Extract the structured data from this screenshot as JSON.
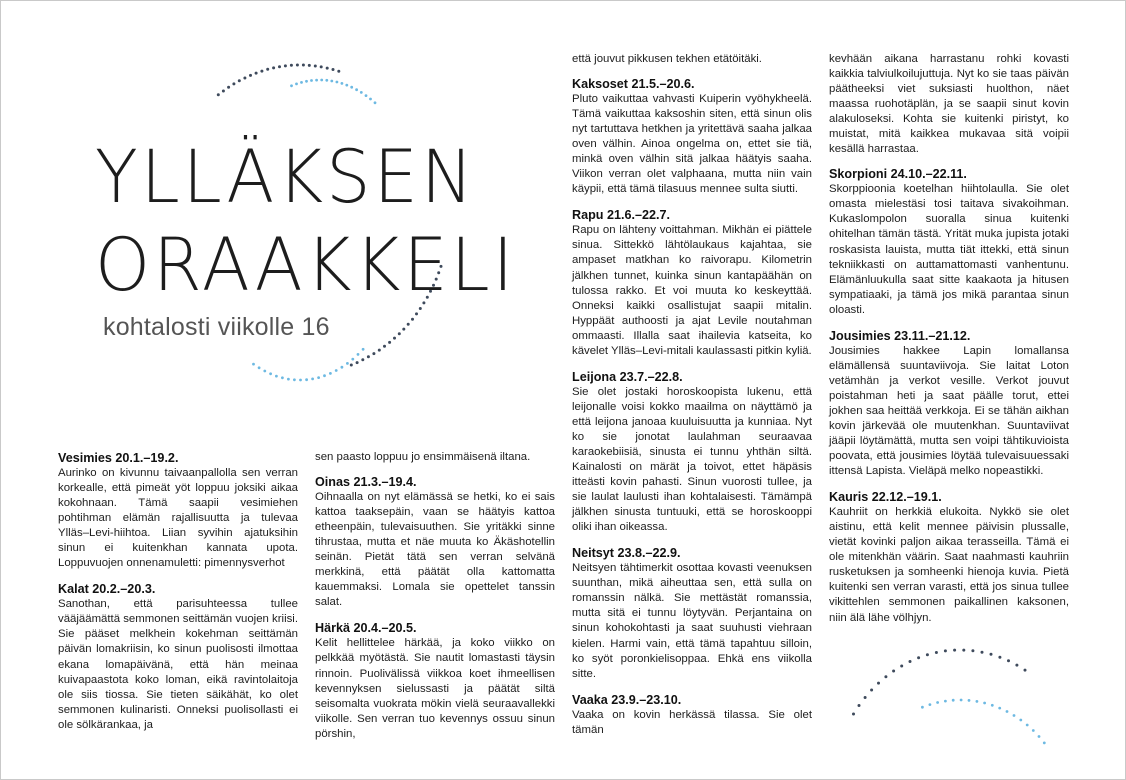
{
  "title": {
    "line1": "YLLÄKSEN",
    "line2": "ORAAKKELI",
    "subtitle": "kohtalosti viikolle 16"
  },
  "columns": [
    {
      "intro": "",
      "signs": [
        {
          "heading": "Vesimies 20.1.–19.2.",
          "text": "Aurinko on kivunnu taivaanpallolla sen verran korkealle, että pimeät yöt loppuu joksiki aikaa kokohnaan. Tämä saapii vesimiehen pohtihman elämän rajallisuutta ja tulevaa Ylläs–Levi-hiihtoa. Liian syvihin ajatuksihin sinun ei kuitenkhan kannata upota. Loppuvuojen onnenamuletti: pimennysverhot"
        },
        {
          "heading": "Kalat 20.2.–20.3.",
          "text": "Sanothan, että parisuhteessa tullee vääjäämättä semmonen seittämän vuojen kriisi. Sie pääset melkhein kokehman seittämän päivän lomakriisin, ko sinun puolisosti ilmottaa ekana lomapäivänä, että hän meinaa kuivapaastota koko loman, eikä ravintolaitoja ole siis tiossa. Sie tieten säikähät, ko olet semmonen kulinaristi. Onneksi puolisollasti ei ole sölkärankaa, ja"
        }
      ]
    },
    {
      "intro": "sen paasto loppuu jo ensimmäisenä iltana.",
      "signs": [
        {
          "heading": "Oinas 21.3.–19.4.",
          "text": "Oihnaalla on nyt elämässä se hetki, ko ei sais kattoa taaksepäin, vaan se häätyis kattoa etheenpäin, tulevaisuuthen. Sie yritäkki sinne tihrustaa, mutta et näe muuta ko Äkäshotellin seinän. Pietät tätä sen verran selvänä merkkinä, että päätät olla kattomatta kauemmaksi. Lomala sie opettelet tanssin salat."
        },
        {
          "heading": "Härkä 20.4.–20.5.",
          "text": "Kelit hellittelee härkää, ja koko viikko on pelkkää myötästä. Sie nautit lomastasti täysin rinnoin. Puolivälissä viikkoa koet ihmeellisen kevennyksen sielussasti ja päätät siltä seisomalta vuokrata mökin vielä seuraavallekki viikolle. Sen verran tuo kevennys ossuu sinun pörshin,"
        }
      ]
    },
    {
      "intro": "että jouvut pikkusen tekhen etätöitäki.",
      "signs": [
        {
          "heading": "Kaksoset 21.5.–20.6.",
          "text": "Pluto vaikuttaa vahvasti Kuiperin vyöhykheelä. Tämä vaikuttaa kaksoshin siten, että sinun olis nyt tartuttava hetkhen ja yritettävä saaha jalkaa oven välhin. Ainoa ongelma on, ettet sie tiä, minkä oven välhin sitä jalkaa häätyis saaha. Viikon verran olet valphaana, mutta niin vain käypii, että tämä tilasuus mennee sulta siutti."
        },
        {
          "heading": "Rapu 21.6.–22.7.",
          "text": "Rapu on lähteny voittahman. Mikhän ei piättele sinua. Sittekkö lähtölaukaus kajahtaa, sie ampaset matkhan ko raivorapu. Kilometrin jälkhen tunnet, kuinka sinun kantapäähän on tulossa rakko. Et voi muuta ko keskeyttää. Onneksi kaikki osallistujat saapii mitalin. Hyppäät authoosti ja ajat Levile noutahman ommaasti. Illalla saat ihailevia katseita, ko kävelet Ylläs–Levi-mitali kaulassasti pitkin kyliä."
        },
        {
          "heading": "Leijona 23.7.–22.8.",
          "text": "Sie olet jostaki horoskoopista lukenu, että leijonalle voisi kokko maailma on näyttämö ja että leijona janoaa kuuluisuutta ja kunniaa. Nyt ko sie jonotat laulahman seuraavaa karaokebiisiä, sinusta ei tunnu yhthän siltä. Kainalosti on märät ja toivot, ettet häpäsis itteästi kovin pahasti. Sinun vuorosti tullee, ja sie laulat laulusti ihan kohtalaisesti. Tämämpä jälkhen sinusta tuntuuki, että se horoskooppi oliki ihan oikeassa."
        },
        {
          "heading": "Neitsyt 23.8.–22.9.",
          "text": "Neitsyen tähtimerkit osottaa kovasti veenuksen suunthan, mikä aiheuttaa sen, että sulla on romanssin nälkä. Sie mettästät romanssia, mutta sitä ei tunnu löytyvän. Perjantaina on sinun kohokohtasti ja saat suuhusti viehraan kielen. Harmi vain, että tämä tapahtuu silloin, ko syöt poronkielisoppaa. Ehkä ens viikolla sitte."
        },
        {
          "heading": "Vaaka 23.9.–23.10.",
          "text": "Vaaka on kovin herkässä tilassa. Sie olet tämän"
        }
      ]
    },
    {
      "intro": "kevhään aikana harrastanu rohki kovasti kaikkia talviulkoilujuttuja. Nyt ko sie taas päivän päätheeksi viet suksiasti huolthon, näet maassa ruohotäplän, ja se saapii sinut kovin alakuloseksi. Kohta sie kuitenki piristyt, ko muistat, mitä kaikkea mukavaa sitä voipii kesällä harrastaa.",
      "signs": [
        {
          "heading": "Skorpioni 24.10.–22.11.",
          "text": "Skorppioonia koetelhan hiihtolaulla. Sie olet omasta mielestäsi tosi taitava sivakoihman. Kukaslompolon suoralla sinua kuitenki ohitelhan tämän tästä. Yrität muka jupista jotaki roskasista lauista, mutta tiät ittekki, että sinun tekniikkasti on auttamattomasti vanhentunu. Elämänluukulla saat sitte kaakaota ja hitusen sympatiaaki, ja tämä jos mikä parantaa sinun oloasti."
        },
        {
          "heading": "Jousimies 23.11.–21.12.",
          "text": "Jousimies hakkee Lapin lomallansa elämällensä suuntaviivoja. Sie laitat Loton vetämhän ja verkot vesille. Verkot jouvut poistahman heti ja saat päälle torut, ettei jokhen saa heittää verkkoja. Ei se tähän aikhan kovin järkevää ole muutenkhan. Suuntaviivat jääpii löytämättä, mutta sen voipi tähtikuvioista poovata, että jousimies löytää tulevaisuuessaki ittensä Lapista. Vieläpä melko nopeastikki."
        },
        {
          "heading": "Kauris 22.12.–19.1.",
          "text": "Kauhriit on herkkiä elukoita. Nykkö sie olet aistinu, että kelit mennee päivisin plussalle, vietät kovinki paljon aikaa terasseilla. Tämä ei ole mitenkhän väärin. Saat naahmasti kauhriin rusketuksen ja somheenki hienoja kuvia. Pietä kuitenki sen verran varasti, että jos sinua tullee vikittehlen semmonen paikallinen kaksonen, niin älä lähe völhjyn."
        }
      ]
    }
  ],
  "colors": {
    "dots_dark": "#3e4a5c",
    "dots_light": "#6db9e2"
  }
}
